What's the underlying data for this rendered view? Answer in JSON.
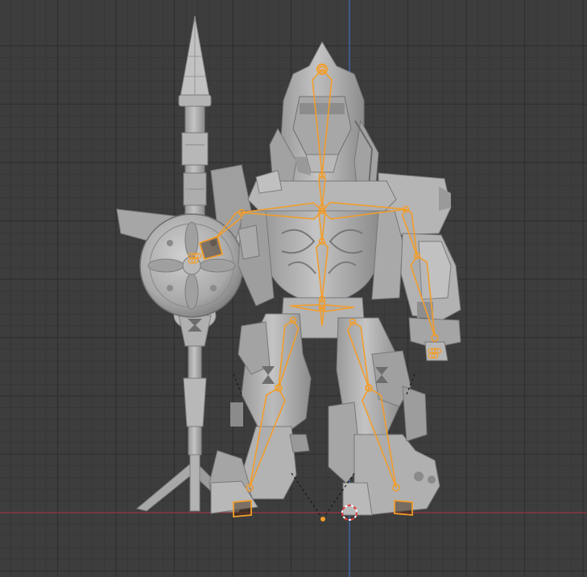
{
  "viewport": {
    "background": "#3d3d3d",
    "grid_minor_color": "#373737",
    "grid_major_color": "#303030",
    "x_axis_color": "#9a3a43",
    "z_axis_color": "#3e6fb6"
  },
  "model": {
    "color": "#bdbdbd",
    "shade_color": "#8e8e8e",
    "dark_color": "#6d6d6d"
  },
  "armature": {
    "color": "#f29d2b",
    "outline_color": "#2a1a08"
  },
  "scene": {
    "origin_color": "#f29d2b",
    "cursor_color": "#e23b3b"
  }
}
